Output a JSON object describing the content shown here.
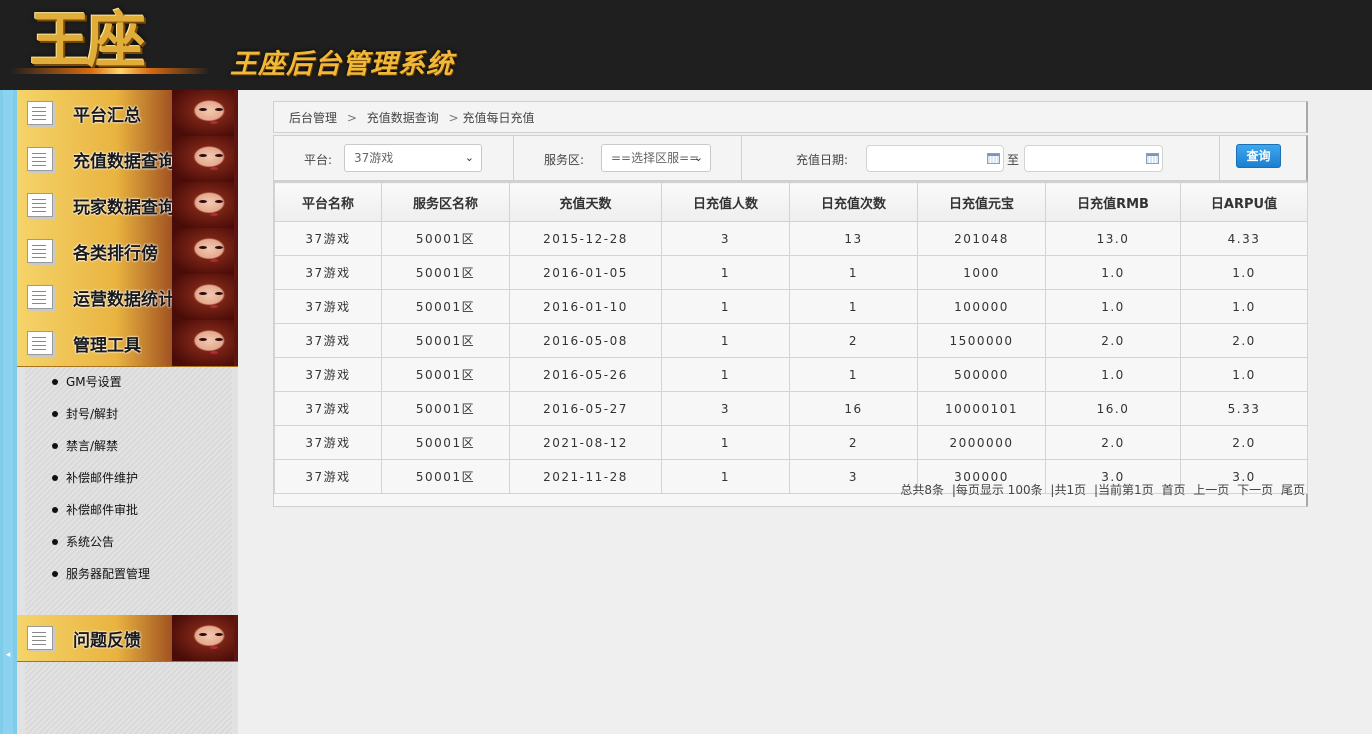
{
  "header": {
    "logo": "王座",
    "title": "王座后台管理系统"
  },
  "sidebar": {
    "menus": [
      {
        "label": "平台汇总"
      },
      {
        "label": "充值数据查询"
      },
      {
        "label": "玩家数据查询"
      },
      {
        "label": "各类排行傍"
      },
      {
        "label": "运营数据统计"
      },
      {
        "label": "管理工具"
      }
    ],
    "submenu": [
      "GM号设置",
      "封号/解封",
      "禁言/解禁",
      "补偿邮件维护",
      "补偿邮件审批",
      "系统公告",
      "服务器配置管理"
    ],
    "feedback": {
      "label": "问题反馈"
    },
    "collapse_icon": "◂"
  },
  "breadcrumb": {
    "root": "后台管理",
    "level1": "充值数据查询",
    "level2": "充值每日充值",
    "sep": ">"
  },
  "filters": {
    "platform_label": "平台:",
    "platform_value": "37游戏",
    "server_label": "服务区:",
    "server_value": "==选择区服==",
    "date_label": "充值日期:",
    "to_label": "至",
    "query_label": "查询",
    "caret": "⌄"
  },
  "table": {
    "columns": [
      "平台名称",
      "服务区名称",
      "充值天数",
      "日充值人数",
      "日充值次数",
      "日充值元宝",
      "日充值RMB",
      "日ARPU值"
    ],
    "rows": [
      [
        "37游戏",
        "50001区",
        "2015-12-28",
        "3",
        "13",
        "201048",
        "13.0",
        "4.33"
      ],
      [
        "37游戏",
        "50001区",
        "2016-01-05",
        "1",
        "1",
        "1000",
        "1.0",
        "1.0"
      ],
      [
        "37游戏",
        "50001区",
        "2016-01-10",
        "1",
        "1",
        "100000",
        "1.0",
        "1.0"
      ],
      [
        "37游戏",
        "50001区",
        "2016-05-08",
        "1",
        "2",
        "1500000",
        "2.0",
        "2.0"
      ],
      [
        "37游戏",
        "50001区",
        "2016-05-26",
        "1",
        "1",
        "500000",
        "1.0",
        "1.0"
      ],
      [
        "37游戏",
        "50001区",
        "2016-05-27",
        "3",
        "16",
        "10000101",
        "16.0",
        "5.33"
      ],
      [
        "37游戏",
        "50001区",
        "2021-08-12",
        "1",
        "2",
        "2000000",
        "2.0",
        "2.0"
      ],
      [
        "37游戏",
        "50001区",
        "2021-11-28",
        "1",
        "3",
        "300000",
        "3.0",
        "3.0"
      ]
    ]
  },
  "pager": {
    "total": "总共8条",
    "per_page": "|每页显示 100条",
    "pages": "|共1页",
    "current": "|当前第1页",
    "first": "首页",
    "prev": "上一页",
    "next": "下一页",
    "last": "尾页"
  }
}
